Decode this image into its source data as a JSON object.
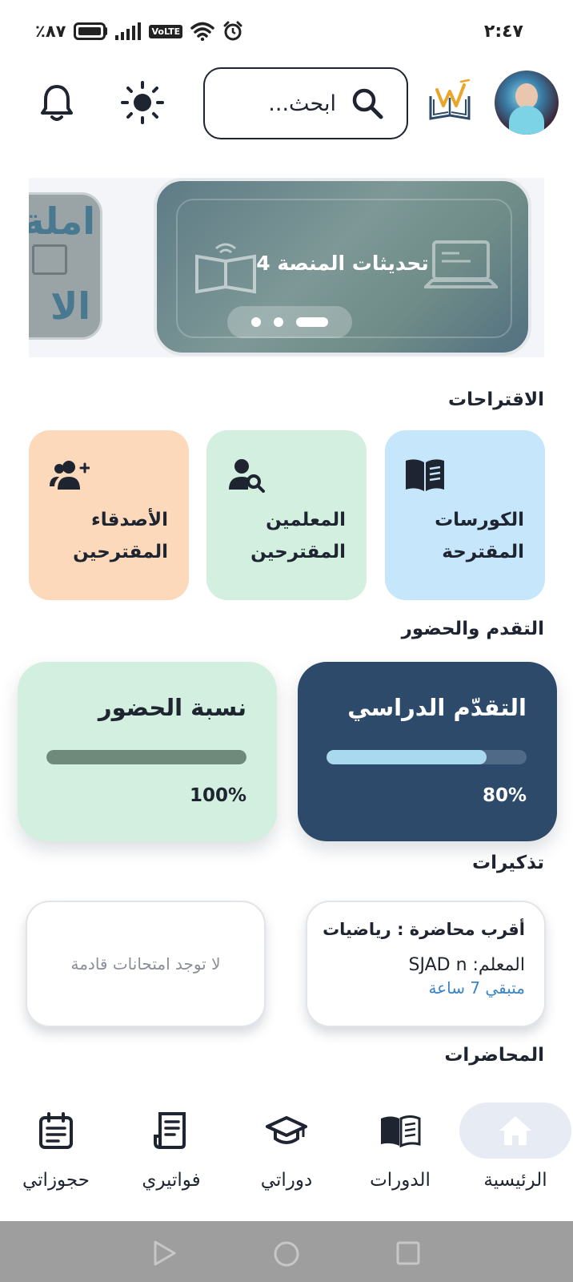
{
  "status_bar": {
    "battery": "٪٨٧",
    "network_badge": "VoLTE",
    "time": "٢:٤٧"
  },
  "header": {
    "search_placeholder": "ابحث..."
  },
  "carousel": {
    "main_slide_title": "تحديثات المنصة 4",
    "side_slide_text_1": "املة",
    "side_slide_text_2": "الا",
    "active_dot": 1,
    "dot_count": 3
  },
  "suggestions": {
    "title": "الاقتراحات",
    "items": [
      {
        "label": "الكورسات المقترحة",
        "icon": "book-icon",
        "color": "#c6e6fb"
      },
      {
        "label": "المعلمين المقترحين",
        "icon": "user-search-icon",
        "color": "#d2efdf"
      },
      {
        "label": "الأصدقاء المقترحين",
        "icon": "user-add-icon",
        "color": "#fdd9bb"
      }
    ]
  },
  "progress": {
    "title": "التقدم والحضور",
    "study": {
      "label": "التقدّم الدراسي",
      "percent_text": "80%",
      "value": 0.8
    },
    "attendance": {
      "label": "نسبة الحضور",
      "percent_text": "100%",
      "value": 1.0
    }
  },
  "reminders": {
    "title": "تذكيرات",
    "next_lecture": {
      "title": "أقرب محاضرة : رياضيات",
      "teacher": "المعلم: SJAD n",
      "remaining": "متبقي 7 ساعة"
    },
    "exams_empty": "لا توجد امتحانات قادمة"
  },
  "lectures": {
    "title": "المحاضرات"
  },
  "bottom_nav": {
    "items": [
      {
        "label": "الرئيسية",
        "icon": "home-icon",
        "active": true
      },
      {
        "label": "الدورات",
        "icon": "book-open-icon",
        "active": false
      },
      {
        "label": "دوراتي",
        "icon": "graduation-cap-icon",
        "active": false
      },
      {
        "label": "فواتيري",
        "icon": "receipt-icon",
        "active": false
      },
      {
        "label": "حجوزاتي",
        "icon": "calendar-list-icon",
        "active": false
      }
    ]
  },
  "colors": {
    "primary_dark": "#2e4a6b",
    "accent_light_blue": "#a9d9ef",
    "link_blue": "#3d84c6",
    "mint": "#d2efdf",
    "peach": "#fdd9bb",
    "sky": "#c6e6fb"
  }
}
